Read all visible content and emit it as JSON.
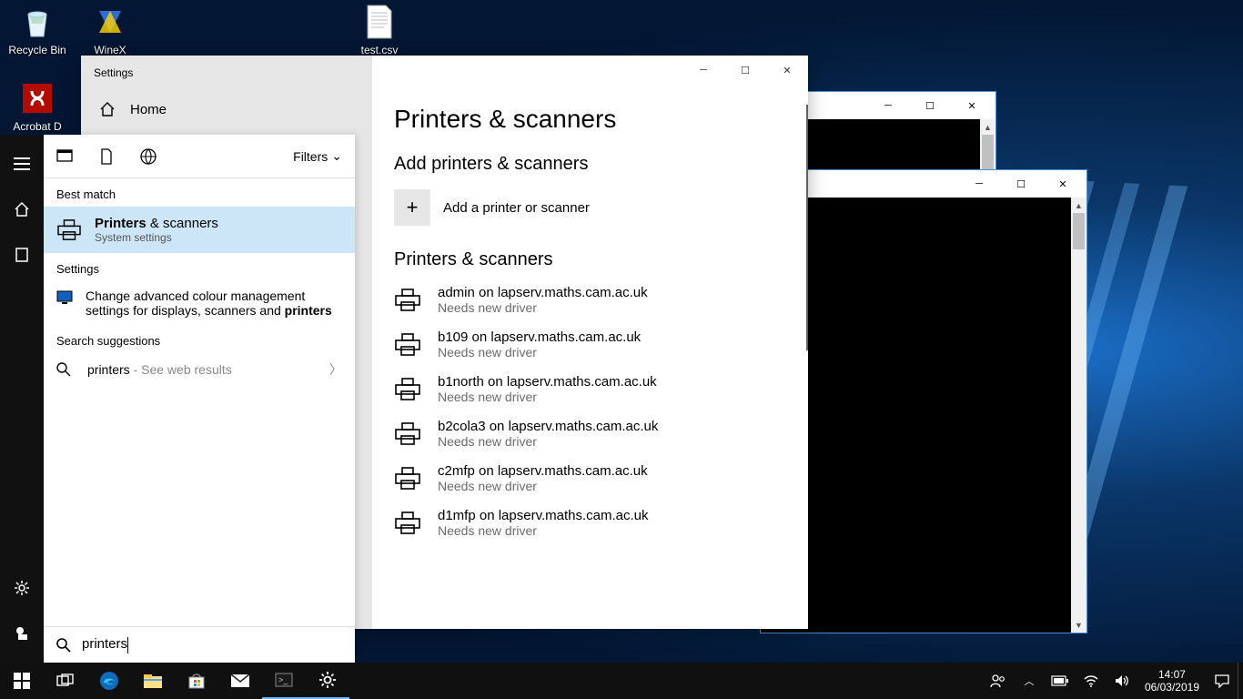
{
  "desktop": {
    "recycle": "Recycle Bin",
    "winex": "WineX",
    "testcsv": "test.csv",
    "acrobat": "Acrobat   D"
  },
  "settings": {
    "appname": "Settings",
    "home": "Home",
    "heading": "Printers & scanners",
    "add_section": "Add printers & scanners",
    "add_label": "Add a printer or scanner",
    "list_section": "Printers & scanners",
    "printers": [
      {
        "name": "admin on lapserv.maths.cam.ac.uk",
        "sub": "Needs new driver"
      },
      {
        "name": "b109 on lapserv.maths.cam.ac.uk",
        "sub": "Needs new driver"
      },
      {
        "name": "b1north on lapserv.maths.cam.ac.uk",
        "sub": "Needs new driver"
      },
      {
        "name": "b2cola3 on lapserv.maths.cam.ac.uk",
        "sub": "Needs new driver"
      },
      {
        "name": "c2mfp on lapserv.maths.cam.ac.uk",
        "sub": "Needs new driver"
      },
      {
        "name": "d1mfp on lapserv.maths.cam.ac.uk",
        "sub": "Needs new driver"
      }
    ]
  },
  "search": {
    "filters": "Filters",
    "bestmatch_label": "Best match",
    "bm_title_bold": "Printers",
    "bm_title_rest": " & scanners",
    "bm_sub": "System settings",
    "settings_label": "Settings",
    "colour_item_pre": "Change advanced colour management settings for displays, scanners and ",
    "colour_item_bold": "printers",
    "suggestions_label": "Search suggestions",
    "sugg_term": "printers",
    "sugg_rest": " - See web results",
    "input_value": "printers"
  },
  "tray": {
    "time": "14:07",
    "date": "06/03/2019"
  }
}
